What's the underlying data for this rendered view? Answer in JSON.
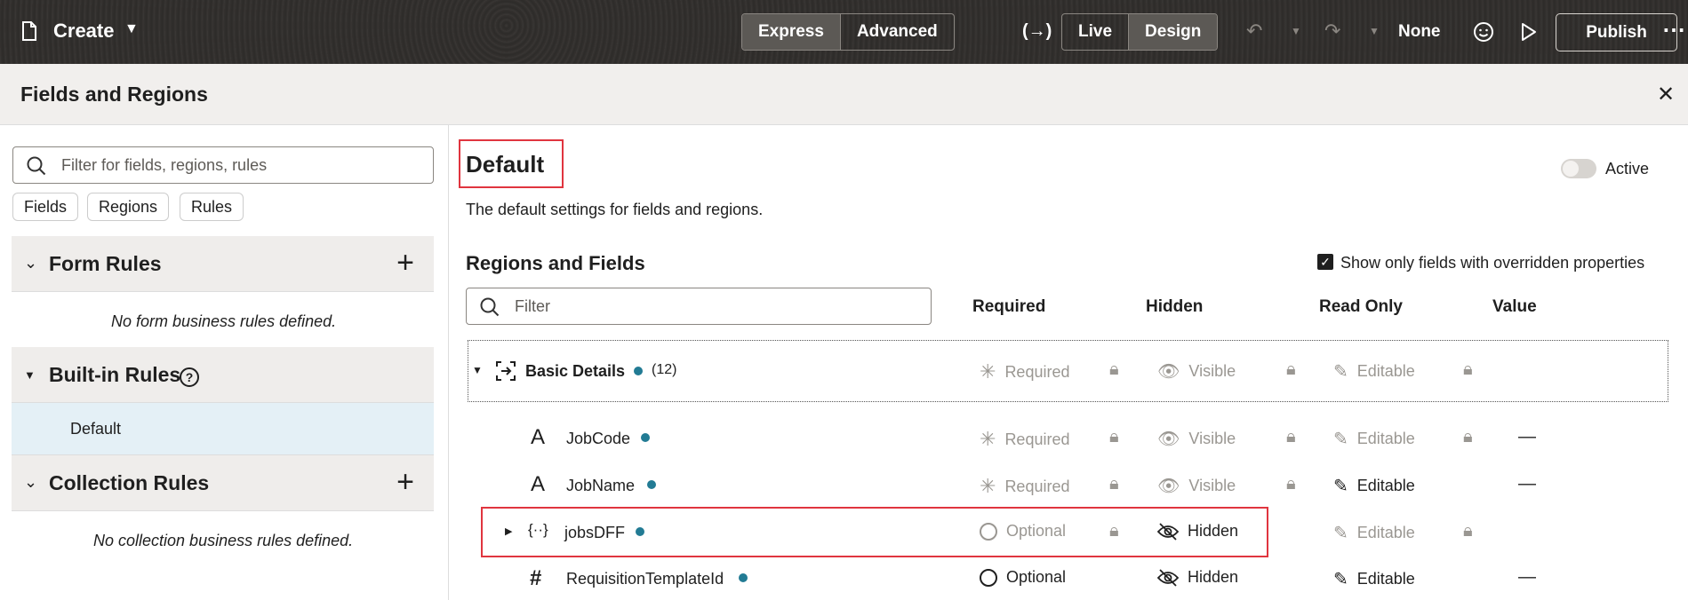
{
  "topbar": {
    "create_label": "Create",
    "mode_express": "Express",
    "mode_advanced": "Advanced",
    "view_live": "Live",
    "view_design": "Design",
    "none_label": "None",
    "publish_label": "Publish"
  },
  "panel": {
    "title": "Fields and Regions"
  },
  "left": {
    "search_placeholder": "Filter for fields, regions, rules",
    "chips": [
      "Fields",
      "Regions",
      "Rules"
    ],
    "form_rules": "Form Rules",
    "form_rules_empty": "No form business rules defined.",
    "builtin_rules": "Built-in Rules",
    "builtin_default": "Default",
    "collection_rules": "Collection Rules",
    "collection_rules_empty": "No collection business rules defined."
  },
  "main": {
    "title": "Default",
    "description": "The default settings for fields and regions.",
    "active_label": "Active",
    "regions_title": "Regions and Fields",
    "override_label": "Show only fields with overridden properties",
    "filter_placeholder": "Filter",
    "columns": {
      "required": "Required",
      "hidden": "Hidden",
      "read_only": "Read Only",
      "value": "Value"
    },
    "region": {
      "name": "Basic Details",
      "count": "(12)",
      "required": "Required",
      "hidden": "Visible",
      "read_only": "Editable"
    },
    "rows": [
      {
        "name": "JobCode",
        "required": "Required",
        "hidden": "Visible",
        "read_only": "Editable",
        "value": "—"
      },
      {
        "name": "JobName",
        "required": "Required",
        "hidden": "Visible",
        "read_only": "Editable",
        "value": "—"
      },
      {
        "name": "jobsDFF",
        "required": "Optional",
        "hidden": "Hidden",
        "read_only": "Editable",
        "value": ""
      },
      {
        "name": "RequisitionTemplateId",
        "required": "Optional",
        "hidden": "Hidden",
        "read_only": "Editable",
        "value": "—"
      }
    ]
  }
}
